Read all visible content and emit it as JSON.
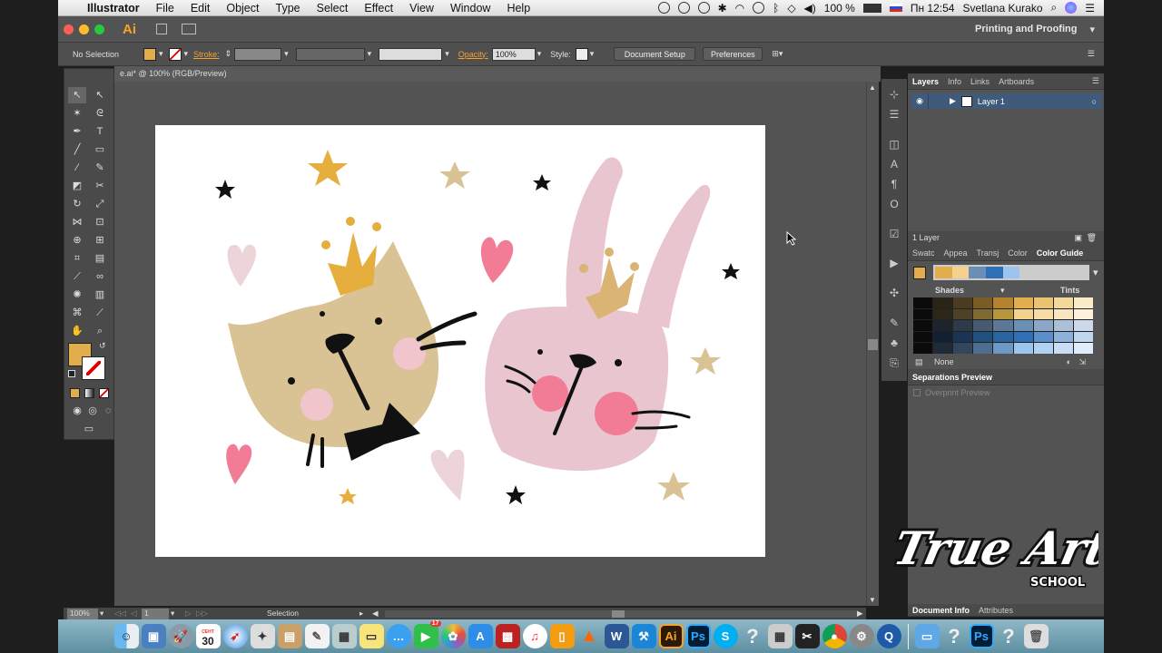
{
  "menubar": {
    "apple": "",
    "app_name": "Illustrator",
    "items": [
      "File",
      "Edit",
      "Object",
      "Type",
      "Select",
      "Effect",
      "View",
      "Window",
      "Help"
    ],
    "battery": "100 %",
    "clock": "Пн 12:54",
    "user": "Svetlana Kurako"
  },
  "appbar": {
    "logo": "Ai",
    "workspace": "Printing and Proofing"
  },
  "control": {
    "selection": "No Selection",
    "stroke_label": "Stroke:",
    "opacity_label": "Opacity:",
    "opacity_value": "100%",
    "style_label": "Style:",
    "document_setup": "Document Setup",
    "preferences": "Preferences"
  },
  "document": {
    "tab_title": "e.ai* @ 100% (RGB/Preview)"
  },
  "status": {
    "zoom": "100%",
    "page": "1",
    "tool": "Selection"
  },
  "layers_panel": {
    "tabs": [
      "Layers",
      "Info",
      "Links",
      "Artboards"
    ],
    "layer_name": "Layer 1",
    "footer": "1 Layer"
  },
  "color_panel": {
    "tabs": [
      "Swatc",
      "Appea",
      "Transj",
      "Color",
      "Color Guide"
    ],
    "shades": "Shades",
    "tints": "Tints",
    "none": "None"
  },
  "separations": {
    "title": "Separations Preview",
    "overprint": "Overprint Preview"
  },
  "bottom_panel": {
    "tabs": [
      "Document Info",
      "Attributes"
    ]
  },
  "dock": {
    "calendar_month": "СЕНТ",
    "calendar_day": "30",
    "badge": "17"
  },
  "watermark": {
    "line1": "True Art",
    "line2": "SCHOOL"
  },
  "colors": {
    "accent_orange": "#f7a22e",
    "fill_swatch": "#e2ad4d",
    "cat": "#d9c394",
    "rabbit": "#e8c5cf",
    "crown": "#e6ae3d",
    "cheek": "#f2a3b3",
    "pink_heart": "#f27c96"
  }
}
